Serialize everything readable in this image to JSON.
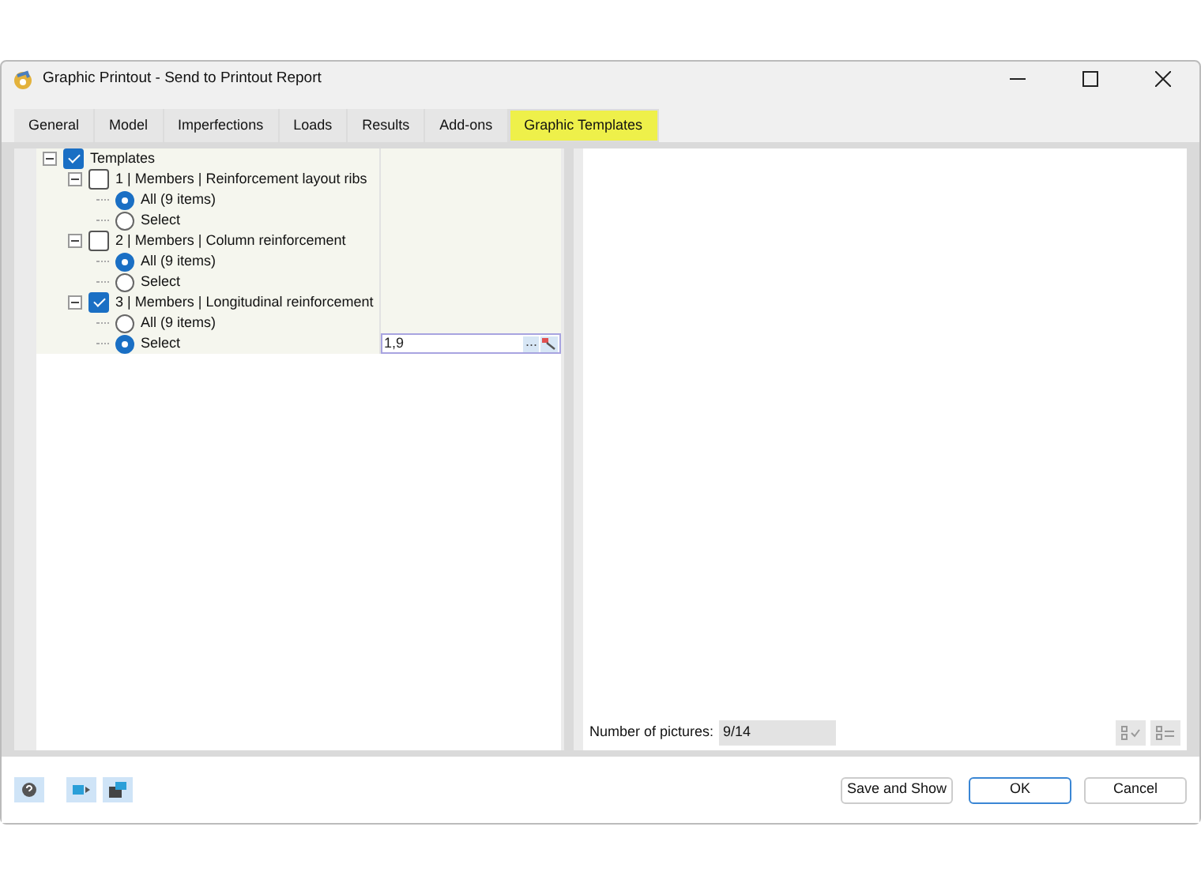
{
  "window": {
    "title": "Graphic Printout - Send to Printout Report"
  },
  "tabs": [
    {
      "label": "General",
      "selected": false
    },
    {
      "label": "Model",
      "selected": false
    },
    {
      "label": "Imperfections",
      "selected": false
    },
    {
      "label": "Loads",
      "selected": false
    },
    {
      "label": "Results",
      "selected": false
    },
    {
      "label": "Add-ons",
      "selected": false
    },
    {
      "label": "Graphic Templates",
      "selected": true
    }
  ],
  "tree": {
    "label": "Templates",
    "checked": true,
    "expanded": true,
    "children": [
      {
        "label": "1 | Members | Reinforcement layout ribs",
        "checked": false,
        "expanded": true,
        "options": [
          {
            "label": "All (9 items)",
            "selected": true
          },
          {
            "label": "Select",
            "selected": false
          }
        ]
      },
      {
        "label": "2 | Members | Column reinforcement",
        "checked": false,
        "expanded": true,
        "options": [
          {
            "label": "All (9 items)",
            "selected": true
          },
          {
            "label": "Select",
            "selected": false
          }
        ]
      },
      {
        "label": "3 | Members | Longitudinal reinforcement",
        "checked": true,
        "expanded": true,
        "options": [
          {
            "label": "All (9 items)",
            "selected": false
          },
          {
            "label": "Select",
            "selected": true,
            "value": "1,9",
            "more": "..."
          }
        ]
      }
    ]
  },
  "preview": {
    "count_label": "Number of pictures:",
    "count": "9/14"
  },
  "buttons": [
    "Save and Show",
    "OK",
    "Cancel"
  ]
}
